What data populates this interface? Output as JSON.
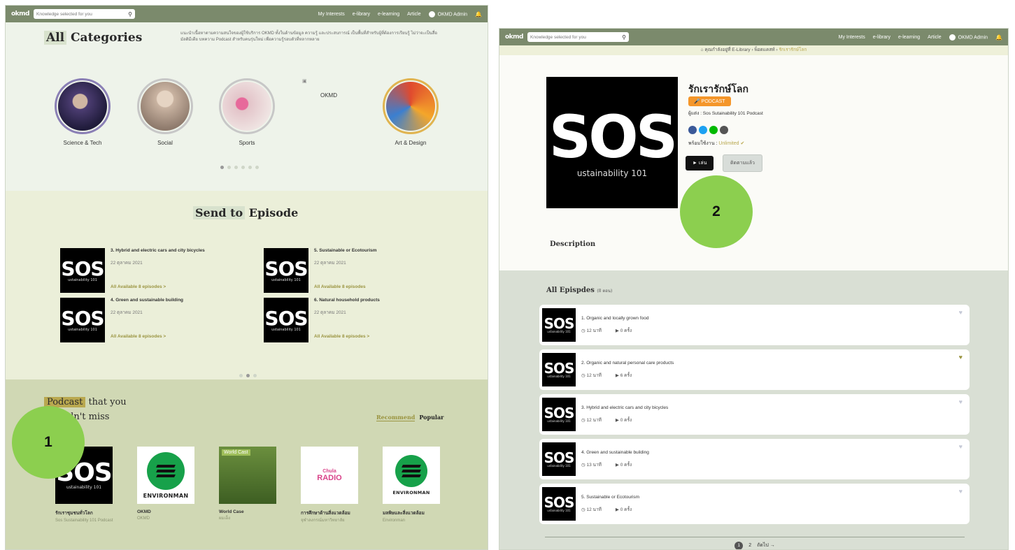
{
  "left": {
    "topbar": {
      "logo": "okmd",
      "search_placeholder": "Knowledge selected for you",
      "nav": [
        "My Interests",
        "e-library",
        "e-learning",
        "Article"
      ],
      "user": "OKMD Admin"
    },
    "categories": {
      "title_hl": "All",
      "title_rest": "Categories",
      "description": "แนะนำเนื้อหาตามความสนใจของผู้ใช้บริการ OKMD ทั้งในด้านข้อมูล ความรู้ และประสบการณ์ เป็นพื้นที่สำหรับผู้ที่ต้องการเรียนรู้ ไม่ว่าจะเป็นสื่อมัลติมีเดีย บทความ Podcast สำหรับคนรุ่นใหม่ เพื่อความรู้รอบตัวที่หลากหลาย",
      "items": [
        {
          "label": "Science & Tech",
          "color": "#4c3d72"
        },
        {
          "label": "Social",
          "color": "#c9b3a1"
        },
        {
          "label": "Sports",
          "color": "#e3c4c9"
        },
        {
          "label": "OKMD",
          "color": ""
        },
        {
          "label": "Art & Design",
          "color": "#e04a2e"
        }
      ]
    },
    "send": {
      "title_hl": "Send to",
      "title_rest": "Episode",
      "episodes": [
        {
          "title": "3. Hybrid and electric cars and city bicycles",
          "date": "22 ตุลาคม 2021",
          "link": "All Available 8 episodes >"
        },
        {
          "title": "5. Sustainable or Ecotourism",
          "date": "22 ตุลาคม 2021",
          "link": "All Available 8 episodes"
        },
        {
          "title": "4. Green and sustainable building",
          "date": "22 ตุลาคม 2021",
          "link": "All Available 8 episodes >"
        },
        {
          "title": "6. Natural household products",
          "date": "22 ตุลาคม 2021",
          "link": "All Available 8 episodes >"
        }
      ]
    },
    "podcast": {
      "title_hl": "Podcast",
      "title_rest": "that you",
      "title_line2": "dn't miss",
      "tab_recommend": "Recommend",
      "tab_popular": "Popular",
      "cards": [
        {
          "name": "รักเราชุมชนทั่วโลก",
          "sub": "Sos Sustainability 101 Podcast"
        },
        {
          "name": "OKMD",
          "sub": "OKMD"
        },
        {
          "name": "World Case",
          "sub": "ผมเอ็ง"
        },
        {
          "name": "การศึกษาด้านสิ่งแวดล้อม",
          "sub": "จุฬาลงกรณ์มหาวิทยาลัย"
        },
        {
          "name": "มลพิษและสิ่งแวดล้อม",
          "sub": "Environman"
        }
      ],
      "environ_text": "ENVIRONMAN",
      "worldcast_text": "World Cast",
      "chula_text": "Chula",
      "radio_text": "RADIO"
    },
    "badge": "1"
  },
  "right": {
    "topbar": {
      "logo": "okmd",
      "search_placeholder": "Knowledge selected for you",
      "nav": [
        "My Interests",
        "e-library",
        "e-learning",
        "Article"
      ],
      "user": "OKMD Admin"
    },
    "breadcrumb": {
      "home": "คุณกำลังอยู่ที่ E-Library",
      "mid": "พ็อดแคสท์",
      "current": "รักเรารักษ์โลก"
    },
    "detail": {
      "title": "รักเรารักษ์โลก",
      "badge": "PODCAST",
      "author": "ผู้แต่ง : Sos Sutainability 101 Podcast",
      "avail_label": "พร้อมใช้งาน :",
      "avail_value": "Unlimited",
      "play": "เล่น",
      "follow": "ติดตามแล้ว",
      "description": "Description",
      "social_colors": [
        "#3b5998",
        "#1da1f2",
        "#00b900",
        "#555555"
      ]
    },
    "sos": {
      "big": "SOS",
      "small": "ustainability 101"
    },
    "episodes_header": "All Epispdes",
    "episodes_count": "(8 ตอน)",
    "episodes": [
      {
        "title": "1. Organic and locally grown food",
        "dur": "12 นาที",
        "plays": "0 ครั้ง",
        "fav": false
      },
      {
        "title": "2. Organic and natural personal care products",
        "dur": "12 นาที",
        "plays": "6 ครั้ง",
        "fav": true
      },
      {
        "title": "3. Hybrid and electric cars and city bicycles",
        "dur": "12 นาที",
        "plays": "0 ครั้ง",
        "fav": false
      },
      {
        "title": "4. Green and sustainable building",
        "dur": "13 นาที",
        "plays": "0 ครั้ง",
        "fav": false
      },
      {
        "title": "5. Sustainable or Ecotourism",
        "dur": "12 นาที",
        "plays": "0 ครั้ง",
        "fav": false
      }
    ],
    "pager": {
      "p1": "1",
      "p2": "2",
      "next": "ถัดไป →"
    },
    "badge": "2"
  }
}
